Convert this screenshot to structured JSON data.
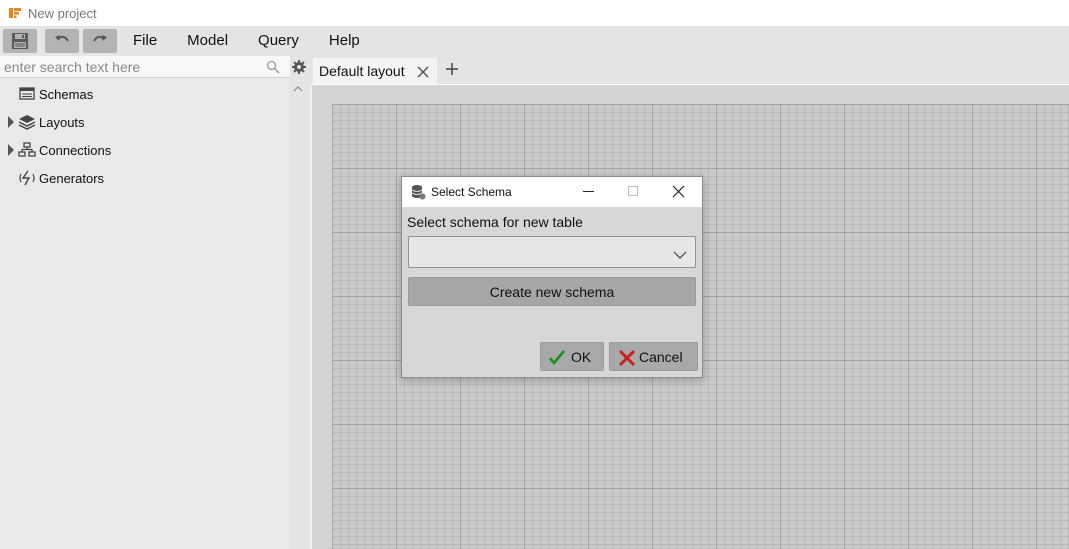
{
  "window": {
    "title": "New project"
  },
  "toolbar": {
    "save_icon": "floppy-disk-icon",
    "undo_icon": "undo-icon",
    "redo_icon": "redo-icon"
  },
  "menu": {
    "items": [
      "File",
      "Model",
      "Query",
      "Help"
    ]
  },
  "search": {
    "placeholder": "enter search text here",
    "value": ""
  },
  "tree": {
    "items": [
      {
        "label": "Schemas",
        "expandable": false,
        "icon": "schemas-icon"
      },
      {
        "label": "Layouts",
        "expandable": true,
        "icon": "layers-icon"
      },
      {
        "label": "Connections",
        "expandable": true,
        "icon": "network-icon"
      },
      {
        "label": "Generators",
        "expandable": false,
        "icon": "generator-icon"
      }
    ]
  },
  "tabs": {
    "items": [
      {
        "label": "Default layout",
        "active": true
      }
    ]
  },
  "dialog": {
    "title": "Select Schema",
    "label": "Select schema for new table",
    "select_value": "",
    "create_label": "Create new schema",
    "ok_label": "OK",
    "cancel_label": "Cancel"
  },
  "colors": {
    "accent_ok": "#1a8f1a",
    "accent_cancel": "#c62020",
    "app_icon": "#e8861a",
    "panel": "#e9e9e9",
    "canvas": "#c9c9c9"
  }
}
